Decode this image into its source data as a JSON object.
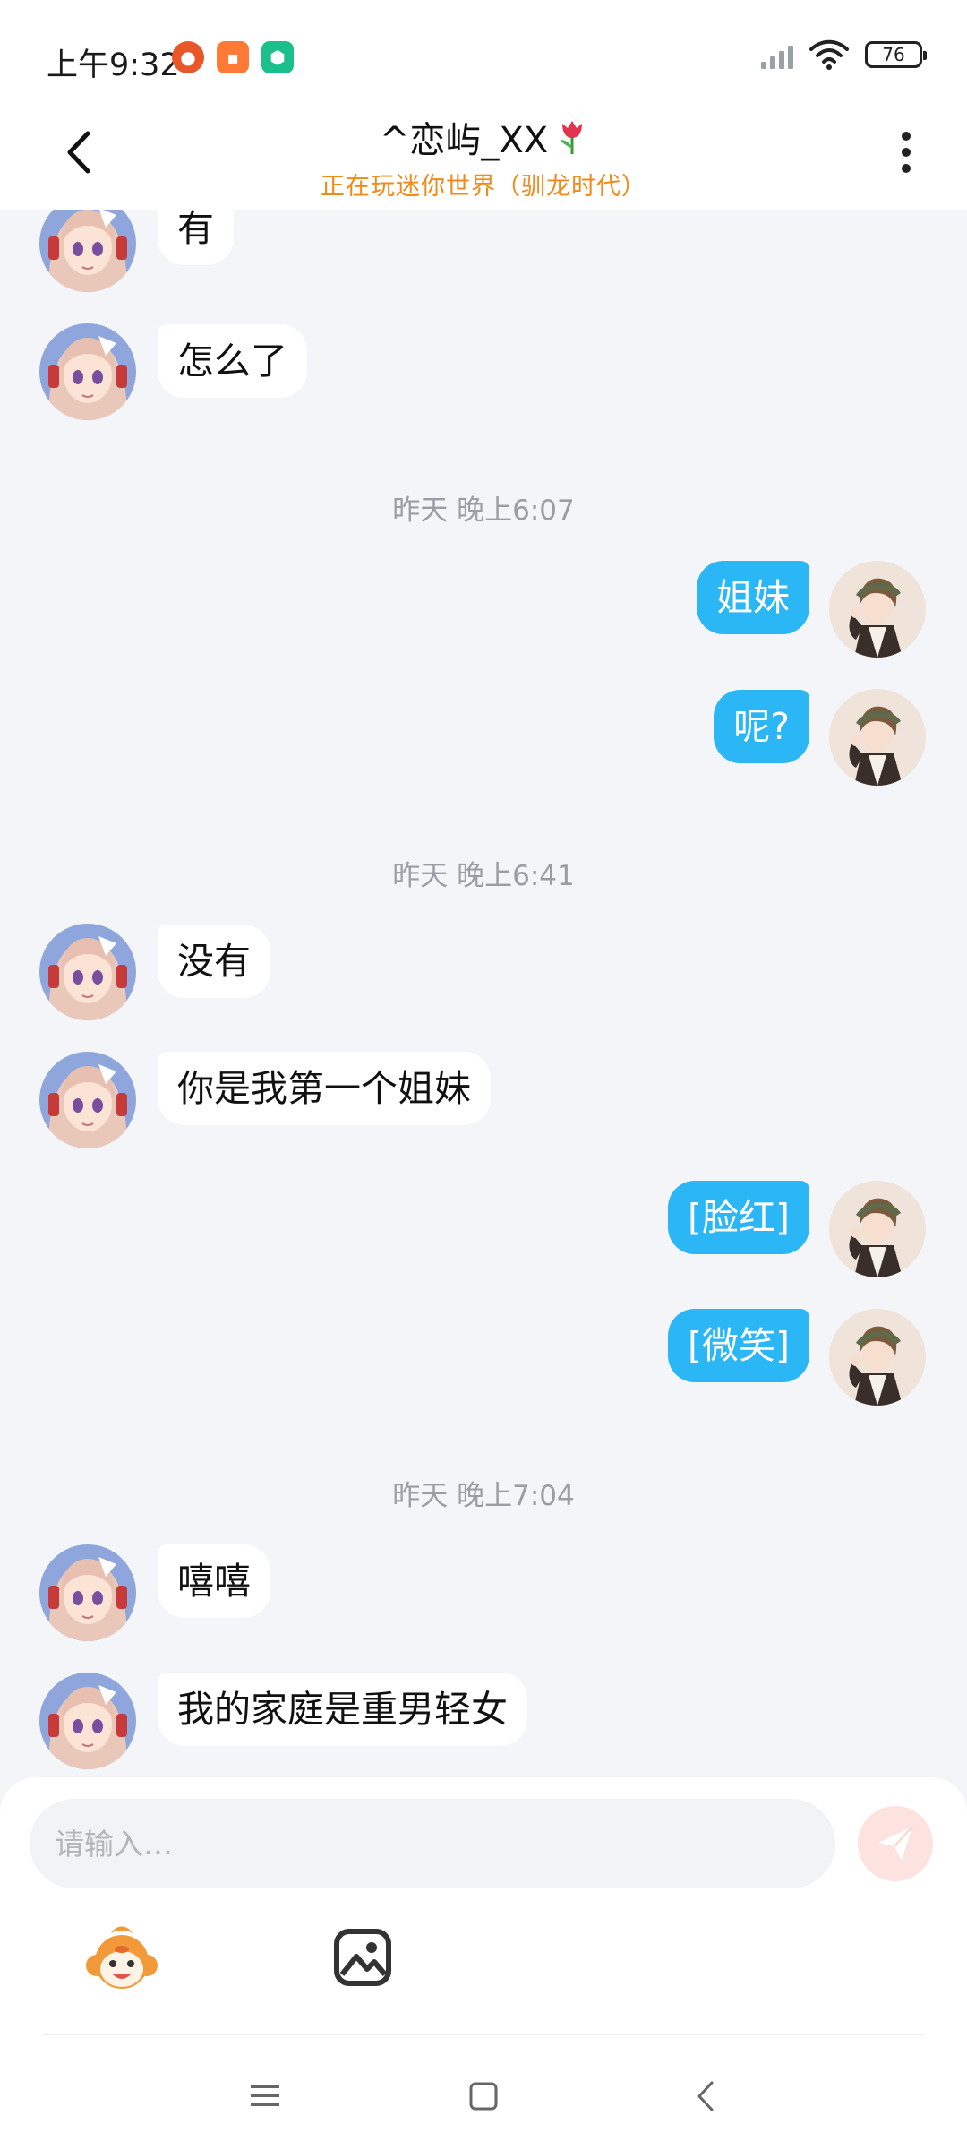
{
  "status_bar": {
    "time": "上午9:32",
    "battery": "76"
  },
  "header": {
    "title": "^恋屿_XX",
    "subtitle": "正在玩迷你世界（驯龙时代）"
  },
  "messages": {
    "m1": "有",
    "m2": "怎么了",
    "ts1": "昨天 晚上6:07",
    "m3": "姐妹",
    "m4": "呢?",
    "ts2": "昨天 晚上6:41",
    "m5": "没有",
    "m6": "你是我第一个姐妹",
    "m7": "[脸红]",
    "m8": "[微笑]",
    "ts3": "昨天 晚上7:04",
    "m9": "嘻嘻",
    "m10": "我的家庭是重男轻女"
  },
  "input": {
    "placeholder": "请输入…"
  },
  "colors": {
    "outgoing_bubble": "#2bb6f5",
    "incoming_bubble": "#ffffff",
    "subtitle": "#f08a1a",
    "background": "#f3f5f8"
  },
  "icons": {
    "back": "chevron-left-icon",
    "more": "more-vertical-icon",
    "send": "paper-plane-icon",
    "sticker": "monkey-face-icon",
    "image": "image-icon"
  }
}
